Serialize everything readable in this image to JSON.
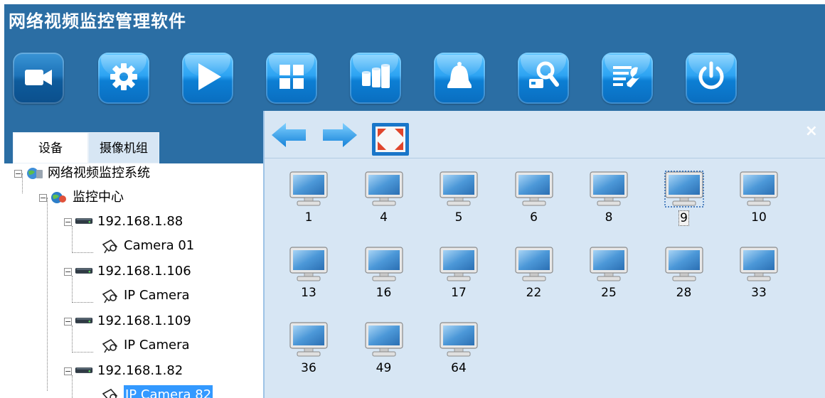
{
  "app": {
    "title": "网络视频监控管理软件"
  },
  "toolbar": {
    "buttons": [
      {
        "icon": "video-camera-icon",
        "active": true
      },
      {
        "icon": "gear-icon"
      },
      {
        "icon": "play-icon"
      },
      {
        "icon": "grid-layout-icon"
      },
      {
        "icon": "storage-drums-icon"
      },
      {
        "icon": "bell-icon"
      },
      {
        "icon": "search-camera-icon"
      },
      {
        "icon": "settings-wrench-icon"
      },
      {
        "icon": "power-icon"
      }
    ]
  },
  "left_panel": {
    "tabs": [
      "设备",
      "摄像机组"
    ],
    "tree": {
      "root": "网络视频监控系统",
      "center": "监控中心",
      "devices": [
        {
          "ip": "192.168.1.88",
          "camera": "Camera 01"
        },
        {
          "ip": "192.168.1.106",
          "camera": "IP Camera"
        },
        {
          "ip": "192.168.1.109",
          "camera": "IP Camera"
        },
        {
          "ip": "192.168.1.82",
          "camera": "IP Camera 82"
        }
      ]
    }
  },
  "right_panel": {
    "close_label": "×",
    "screen_layouts": [
      "1",
      "4",
      "5",
      "6",
      "8",
      "9",
      "10",
      "13",
      "16",
      "17",
      "22",
      "25",
      "28",
      "33",
      "36",
      "49",
      "64"
    ],
    "selected_layout": "9"
  },
  "colors": {
    "title_bar": "#2b6ea4",
    "panel_bg": "#d7e6f4",
    "button_blue": "#2da3f2",
    "selection": "#3399ff"
  }
}
